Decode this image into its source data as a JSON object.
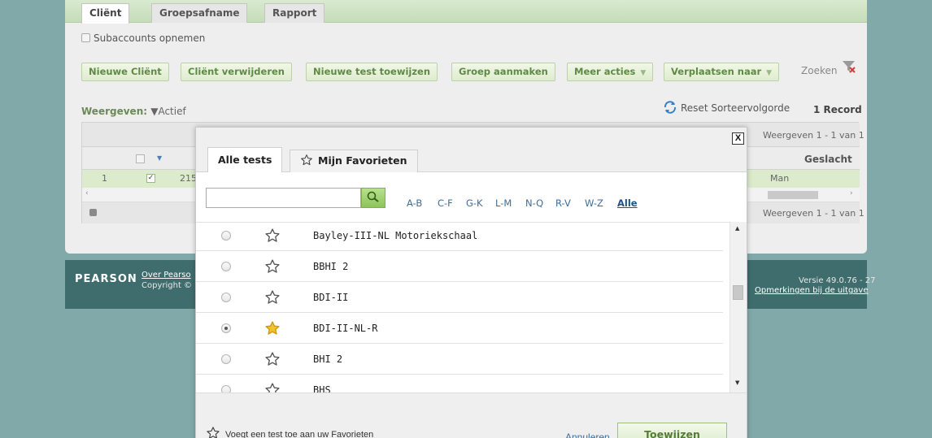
{
  "tabs": [
    "Cliënt",
    "Groepsafname",
    "Rapport"
  ],
  "subaccounts_label": "Subaccounts opnemen",
  "toolbar": {
    "nieuwe_client": "Nieuwe Cliënt",
    "client_verwijderen": "Cliënt verwijderen",
    "nieuwe_test": "Nieuwe test toewijzen",
    "groep_aanmaken": "Groep aanmaken",
    "meer_acties": "Meer acties",
    "verplaatsen": "Verplaatsen naar",
    "zoeken": "Zoeken"
  },
  "filter": {
    "label": "Weergeven:",
    "value": "▼Actief"
  },
  "reset_label": "Reset Sorteervolgorde",
  "record_count": "1 Record",
  "grid": {
    "range_top": "Weergeven 1 - 1 van 1",
    "range_bottom": "Weergeven 1 - 1 van 1",
    "col_geslacht": "Geslacht",
    "row_index": "1",
    "row_id": "215",
    "row_geslacht": "Man"
  },
  "footer": {
    "brand": "PEARSON",
    "over": "Over Pearso",
    "copyright": "Copyright ©",
    "versie": "Versie 49.0.76 - 27",
    "opmerkingen": "Opmerkingen bij de uitgave"
  },
  "modal": {
    "close": "X",
    "tab_all": "Alle tests",
    "tab_fav": "Mijn Favorieten",
    "search_placeholder": "",
    "alpha": [
      "A-B",
      "C-F",
      "G-K",
      "L-M",
      "N-Q",
      "R-V",
      "W-Z"
    ],
    "alpha_all": "Alle",
    "tests": [
      {
        "name": "Bayley-III-NL Motoriekschaal",
        "selected": false,
        "favorite": false
      },
      {
        "name": "BBHI 2",
        "selected": false,
        "favorite": false
      },
      {
        "name": "BDI-II",
        "selected": false,
        "favorite": false
      },
      {
        "name": "BDI-II-NL-R",
        "selected": true,
        "favorite": true
      },
      {
        "name": "BHI 2",
        "selected": false,
        "favorite": false
      },
      {
        "name": "BHS",
        "selected": false,
        "favorite": false
      }
    ],
    "hint": "Voegt een test toe aan uw Favorieten",
    "cancel": "Annuleren",
    "assign": "Toewijzen"
  },
  "colors": {
    "accent_green": "#8dc45b",
    "star_gold": "#f2c12e",
    "link_blue": "#3c6e9c"
  }
}
